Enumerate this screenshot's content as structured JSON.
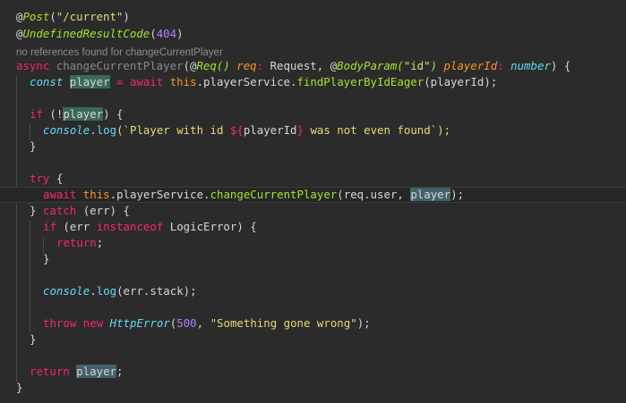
{
  "codelens": "no references found for changeCurrentPlayer",
  "code": {
    "l1": {
      "at": "@",
      "dec": "Post",
      "open": "(",
      "str": "\"/current\"",
      "close": ")"
    },
    "l2": {
      "at": "@",
      "dec": "UndefinedResultCode",
      "open": "(",
      "num": "404",
      "close": ")"
    },
    "l3": {
      "async": "async",
      "name": " changeCurrentPlayer",
      "p1": "(",
      "at1": "@",
      "req_dec": "Req",
      "req_paren": "() ",
      "req": "req",
      "colon1": ": ",
      "req_type": "Request",
      "comma": ", ",
      "at2": "@",
      "body_dec": "BodyParam",
      "bp_open": "(",
      "bp_str": "\"id\"",
      "bp_close": ") ",
      "pid": "playerId",
      "colon2": ": ",
      "pid_type": "number",
      "end": ") {"
    },
    "l4": {
      "const": "const",
      "sp1": " ",
      "player": "player",
      "eq": " = ",
      "await": "await",
      "sp2": " ",
      "this": "this",
      "dot1": ".playerService.",
      "fn": "findPlayerByIdEager",
      "args": "(playerId);"
    },
    "l6": {
      "if": "if",
      "mid": " (!",
      "player": "player",
      "end": ") {"
    },
    "l7": {
      "console": "console",
      "dot": ".",
      "log": "log",
      "pre": "(`Player with id ",
      "interp": "${",
      "var": "playerId",
      "interp_end": "}",
      "post": " was not even found`);"
    },
    "l8": {
      "brace": "}"
    },
    "l10": {
      "try": "try",
      "end": " {"
    },
    "l11": {
      "await": "await",
      "sp1": " ",
      "this": "this",
      "dot": ".playerService.",
      "fn": "changeCurrentPlayer",
      "args": "(req.user, ",
      "player": "player",
      "end": ");"
    },
    "l12": {
      "brace": "} ",
      "catch": "catch",
      "end": " (err) {"
    },
    "l13": {
      "if": "if",
      "pre": " (err ",
      "instanceof": "instanceof",
      "post": " LogicError) {"
    },
    "l14": {
      "return": "return",
      "end": ";"
    },
    "l15": {
      "brace": "}"
    },
    "l17": {
      "console": "console",
      "dot": ".",
      "log": "log",
      "args": "(err.stack);"
    },
    "l19": {
      "throw": "throw",
      "sp1": " ",
      "new": "new",
      "sp2": " ",
      "cls": "HttpError",
      "open": "(",
      "num": "500",
      "comma": ", ",
      "str": "\"Something gone wrong\"",
      "end": ");"
    },
    "l20": {
      "brace": "}"
    },
    "l22": {
      "return": "return",
      "sp": " ",
      "player": "player",
      "end": ";"
    },
    "l23": {
      "brace": "}"
    }
  }
}
